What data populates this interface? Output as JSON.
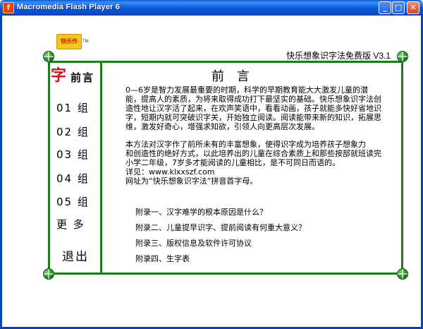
{
  "window": {
    "title": "Macromedia Flash Player 6",
    "minimize": "_",
    "maximize": "□",
    "close": "✕"
  },
  "logo": {
    "text": "快乐作",
    "tm": "TM"
  },
  "app_title": "快乐想象识字法免费版 V3.1",
  "sidebar": {
    "icon_char": "字",
    "preface": "前言",
    "items": [
      {
        "label": "01 组"
      },
      {
        "label": "02 组"
      },
      {
        "label": "03 组"
      },
      {
        "label": "04 组"
      },
      {
        "label": "05 组"
      },
      {
        "label": "更 多"
      }
    ],
    "exit": "退出"
  },
  "main": {
    "heading": "前 言",
    "paragraph1": [
      "0—6岁是智力发展最重要的时期，科学的早期教育能大大激发儿童的潜",
      "能，提高人的素质，为将来取得成功打下最坚实的基础。快乐想象识字法创",
      "造性地让汉字活了起来，在欢声笑语中，看看动画，孩子就能多快好省地识",
      "字，短期内就可突破识字关，开始独立阅读。阅读能带来新的知识，拓展思",
      "维，激发好奇心，增强求知欲，引领人向更高层次发展。"
    ],
    "paragraph2": [
      "本方法对汉字作了前所未有的丰富想象，使得识字成为培养孩子想象力",
      "和创造性的绝好方式，以此培养出的儿童在综合素质上和那些按部就班读完",
      "小学二年级，7岁多才能阅读的儿童相比，是不可同日而语的。",
      "详见：www.klxxszf.com",
      "网址为“快乐想象识字法”拼音首字母。"
    ],
    "appendix": [
      "附录一、汉字难学的根本原因是什么？",
      "附录二、儿童提早识字、提前阅读有何重大意义？",
      "附录三、版权信息及软件许可协议",
      "附录四、生字表"
    ]
  }
}
